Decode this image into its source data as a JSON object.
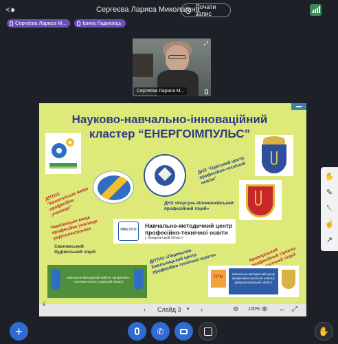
{
  "header": {
    "back_icon": "back-person-icon",
    "title": "Сергеєва Лариса Миколаївна",
    "record_label": "Почати запис",
    "signal_icon": "signal-bars-icon",
    "accent": "#3a8a5c"
  },
  "speakers": [
    {
      "name": "Сергеєва Лариса М..."
    },
    {
      "name": "Ірина Ладиюєць"
    }
  ],
  "video": {
    "name": "Сергеєва Лариса М..."
  },
  "slide": {
    "title_line1": "Науково-навчально-інноваційний",
    "title_line2": "кластер “ЕНЕРГОІМПУЛЬС”",
    "background": "#dde978",
    "notes": {
      "odesa": "ДНЗ “Одеський центр\nпрофесійно-технічної\nосвіти”",
      "konotop": "ДПТНЗ\n“Конотопське вище\nпрофесійне\nучилище”",
      "chernivtsi": "Чернівецьке вище\nпрофесійне училище\nрадіоелектроніки",
      "korsun": "ДНЗ «Корсунь-Шевченківський\nпрофесійний ліцей»",
      "svalyava": "Свалявський\nбудівельний ліцей",
      "pereyaslav": "ДПТНЗ «Переяслав-\nХмельницький центр\nпрофесійно-технічної освіти»",
      "kryvyi": "Криворізький\nпрофесійний гірничо-\nтехнологічний ліцей"
    },
    "nmc_title_1": "Навчально-методичний центр",
    "nmc_title_2": "професійно-технічної освіти",
    "nmc_sub": "у Закарпатській області",
    "nmc_badge": "НМЦ ПТО",
    "kyiv_text": "Навчально-методичний кабінет професійно-технічної освіти у Київській області",
    "dnipro_pto": "ПТО",
    "dnipro_text": "Навчально-методичний центр професійно-технічної освіти у Дніпропетровській області"
  },
  "presentation_bar": {
    "slide_label": "Слайд 3",
    "zoom": "100%"
  },
  "tools": [
    "hand-icon",
    "pen-icon",
    "trash-icon",
    "pointer-icon",
    "chart-icon"
  ],
  "controls": [
    "add-icon",
    "mic-icon",
    "phone-icon",
    "camera-icon",
    "share-screen-icon",
    "raise-hand-icon"
  ]
}
